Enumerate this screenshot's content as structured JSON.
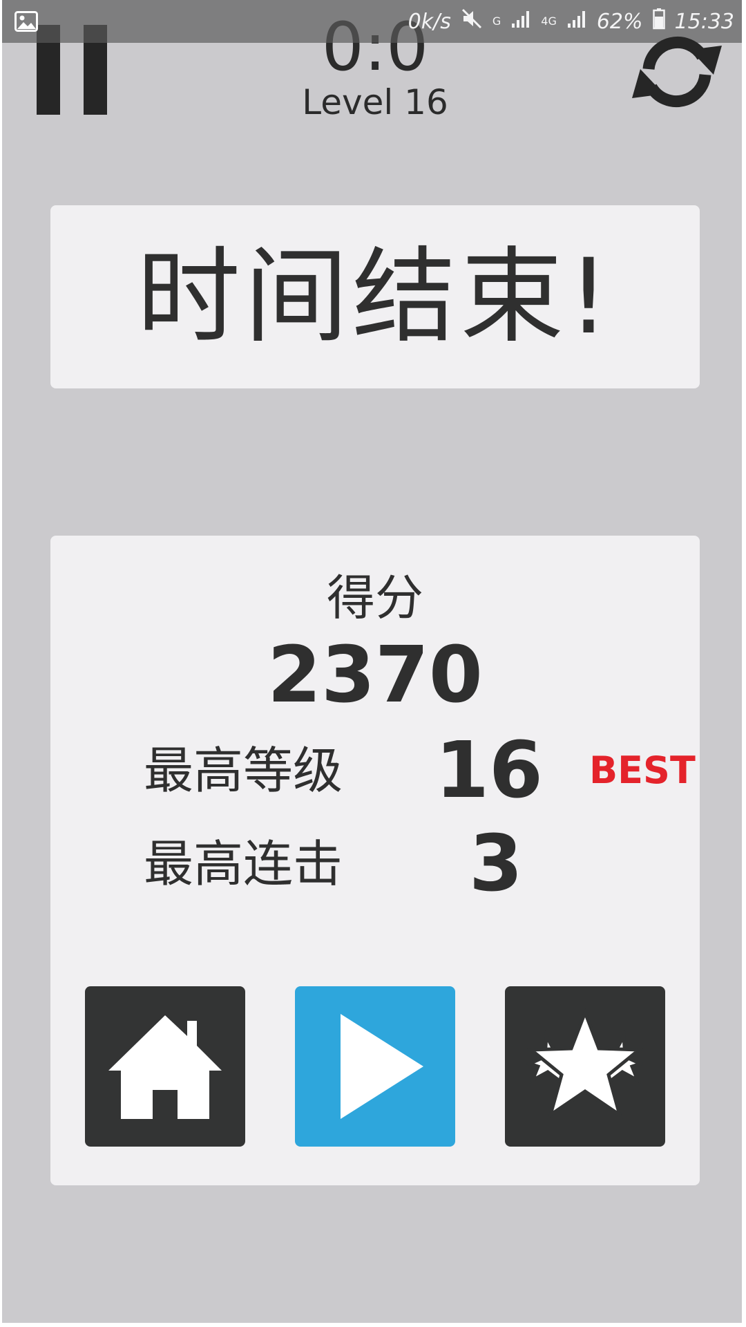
{
  "status_bar": {
    "net_speed": "0k/s",
    "network_g": "G",
    "network_4g": "4G",
    "battery": "62%",
    "time": "15:33",
    "icons": [
      "gallery-icon",
      "mute-icon",
      "signal-icon",
      "signal-icon",
      "battery-icon"
    ]
  },
  "hud": {
    "score_ratio": "0:0",
    "level": "Level 16",
    "icons": [
      "pause-icon",
      "refresh-icon"
    ]
  },
  "timeup": {
    "text": "时间结束!"
  },
  "results": {
    "score_label": "得分",
    "score_value": "2370",
    "max_level_label": "最高等级",
    "max_level_value": "16",
    "best_badge": "BEST",
    "max_combo_label": "最高连击",
    "max_combo_value": "3"
  },
  "actions": {
    "icons": [
      "home-icon",
      "play-icon",
      "stars-icon"
    ]
  },
  "colors": {
    "background": "#cbcacd",
    "card": "#f1f0f2",
    "dark_button": "#333434",
    "play_button": "#2ea6dc",
    "best_badge": "#e4232b",
    "text": "#2f2f2f"
  }
}
